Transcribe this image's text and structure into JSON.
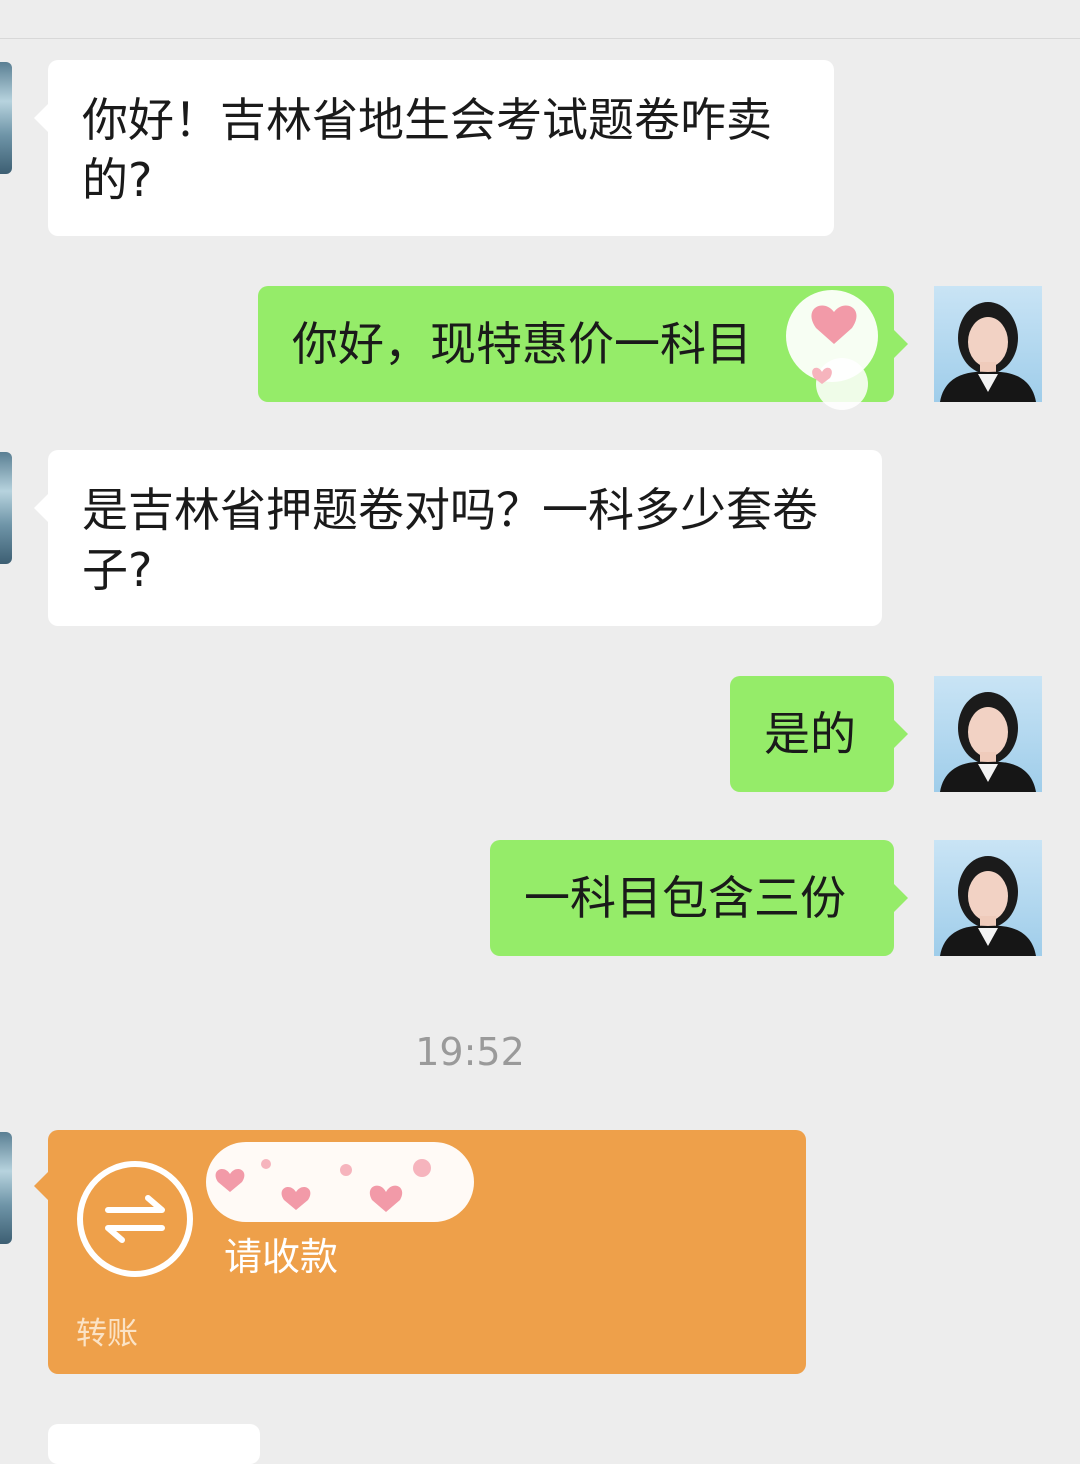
{
  "messages": [
    {
      "dir": "in",
      "text": "你好！吉林省地生会考试题卷咋卖的?"
    },
    {
      "dir": "out",
      "text": "你好，现特惠价一科目"
    },
    {
      "dir": "in",
      "text": "是吉林省押题卷对吗？一科多少套卷子?"
    },
    {
      "dir": "out",
      "text": "是的"
    },
    {
      "dir": "out",
      "text": "一科目包含三份"
    }
  ],
  "timestamp": "19:52",
  "transfer": {
    "note": "请收款",
    "label": "转账",
    "icon": "transfer-arrows-icon"
  },
  "colors": {
    "bg": "#ededed",
    "incoming": "#ffffff",
    "outgoing": "#95ec69",
    "transfer": "#eea04a"
  }
}
